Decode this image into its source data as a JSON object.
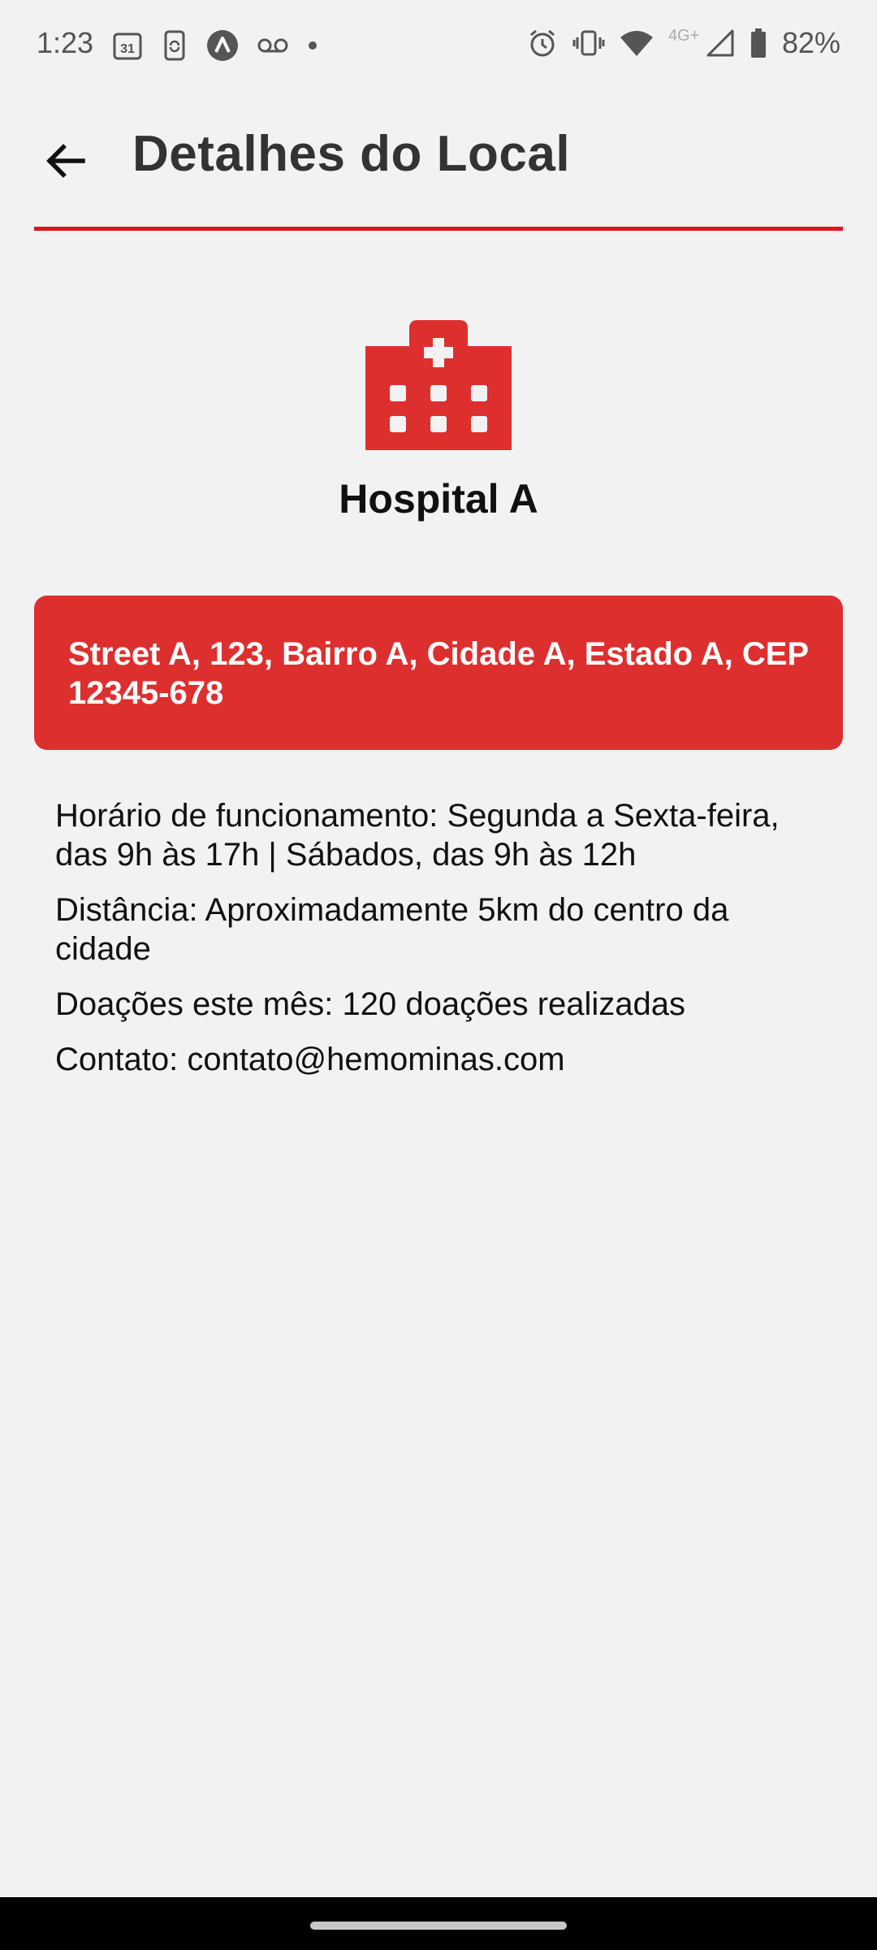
{
  "status_bar": {
    "time": "1:23",
    "calendar_day": "31",
    "network_label": "4G+",
    "battery_percent": "82%",
    "left_icons": [
      "calendar-icon",
      "phone-sync-icon",
      "app-badge-icon",
      "voicemail-icon",
      "dot-icon"
    ],
    "right_icons": [
      "alarm-icon",
      "vibrate-icon",
      "wifi-icon",
      "signal-icon",
      "battery-icon"
    ]
  },
  "app_bar": {
    "title": "Detalhes do Local",
    "back_icon": "arrow-left-icon"
  },
  "place": {
    "icon": "hospital-icon",
    "name": "Hospital A",
    "address": "Street A, 123, Bairro A, Cidade A, Estado A, CEP 12345-678",
    "hours": "Horário de funcionamento: Segunda a Sexta-feira, das 9h às 17h |  Sábados, das 9h às 12h",
    "distance": "Distância: Aproximadamente 5km do centro da cidade",
    "donations": "Doações este mês: 120 doações realizadas",
    "contact": "Contato: contato@hemominas.com"
  },
  "colors": {
    "accent": "#e0161e",
    "card": "#de2f2f",
    "background": "#f2f2f2"
  }
}
